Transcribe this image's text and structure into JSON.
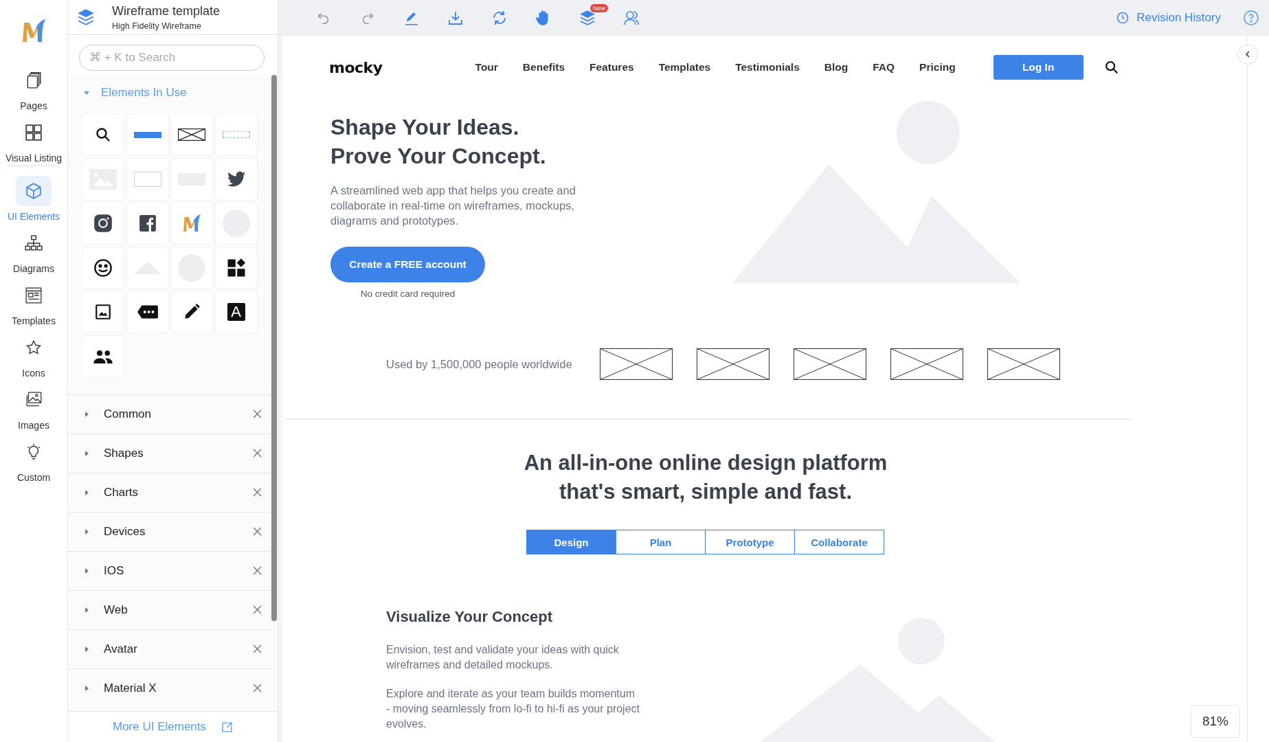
{
  "rail": {
    "items": [
      {
        "label": "Pages",
        "selected": false
      },
      {
        "label": "Visual Listing",
        "selected": false
      },
      {
        "label": "UI Elements",
        "selected": true
      },
      {
        "label": "Diagrams",
        "selected": false
      },
      {
        "label": "Templates",
        "selected": false
      },
      {
        "label": "Icons",
        "selected": false
      },
      {
        "label": "Images",
        "selected": false
      },
      {
        "label": "Custom",
        "selected": false
      }
    ]
  },
  "panel": {
    "title": "Wireframe template",
    "subtitle": "High Fidelity Wireframe",
    "search": {
      "placeholder": "⌘ + K to Search"
    },
    "section": {
      "label": "Elements In Use",
      "expanded": true,
      "tiles": [
        {
          "kind": "search"
        },
        {
          "kind": "button"
        },
        {
          "kind": "crossbox"
        },
        {
          "kind": "outline-button"
        },
        {
          "kind": "image"
        },
        {
          "kind": "outline-rect"
        },
        {
          "kind": "filled-rect"
        },
        {
          "kind": "bird"
        },
        {
          "kind": "camera"
        },
        {
          "kind": "social"
        },
        {
          "kind": "logo"
        },
        {
          "kind": "circle"
        },
        {
          "kind": "smiley"
        },
        {
          "kind": "triangle"
        },
        {
          "kind": "circle"
        },
        {
          "kind": "widgets"
        },
        {
          "kind": "image-icon"
        },
        {
          "kind": "tag"
        },
        {
          "kind": "pencil"
        },
        {
          "kind": "letter",
          "label": "A"
        },
        {
          "kind": "people"
        }
      ]
    },
    "categories": [
      {
        "label": "Common",
        "expanded": false
      },
      {
        "label": "Shapes",
        "expanded": false
      },
      {
        "label": "Charts",
        "expanded": false
      },
      {
        "label": "Devices",
        "expanded": false
      },
      {
        "label": "IOS",
        "expanded": false
      },
      {
        "label": "Web",
        "expanded": false
      },
      {
        "label": "Avatar",
        "expanded": false
      },
      {
        "label": "Material X",
        "expanded": false
      }
    ],
    "footer_link": "More UI Elements"
  },
  "toolbar": {
    "tools": [
      {
        "kind": "undo"
      },
      {
        "kind": "redo"
      },
      {
        "kind": "pen"
      },
      {
        "kind": "download"
      },
      {
        "kind": "sync"
      },
      {
        "kind": "hand"
      },
      {
        "kind": "layers",
        "badge": "New"
      },
      {
        "kind": "users"
      }
    ],
    "revision_history": "Revision History"
  },
  "site": {
    "logo": "mocky",
    "nav": [
      "Tour",
      "Benefits",
      "Features",
      "Templates",
      "Testimonials",
      "Blog",
      "FAQ",
      "Pricing"
    ],
    "login": "Log In",
    "hero": {
      "title_lines": [
        "Shape Your Ideas.",
        "Prove Your Concept."
      ],
      "description": "A streamlined web app that helps you create and collaborate in real-time on wireframes, mockups, diagrams and prototypes.",
      "cta": "Create a FREE account",
      "cta_note": "No credit card required"
    },
    "social_proof": {
      "text": "Used by 1,500,000 people worldwide",
      "logos": [
        {
          "kind": "placeholder"
        },
        {
          "kind": "placeholder"
        },
        {
          "kind": "placeholder"
        },
        {
          "kind": "placeholder"
        },
        {
          "kind": "placeholder"
        }
      ]
    },
    "platform": {
      "heading_lines": [
        "An all-in-one online design platform",
        "that's smart, simple and fast."
      ],
      "tabs": [
        {
          "label": "Design",
          "selected": true
        },
        {
          "label": "Plan",
          "selected": false
        },
        {
          "label": "Prototype",
          "selected": false
        },
        {
          "label": "Collaborate",
          "selected": false
        }
      ],
      "feature": {
        "title": "Visualize Your Concept",
        "paragraphs": [
          "Envision, test and validate your ideas with quick wireframes and detailed mockups.",
          "Explore and iterate as your team builds momentum - moving seamlessly from lo-fi to hi-fi as your project evolves."
        ]
      }
    }
  },
  "zoom": "81%"
}
